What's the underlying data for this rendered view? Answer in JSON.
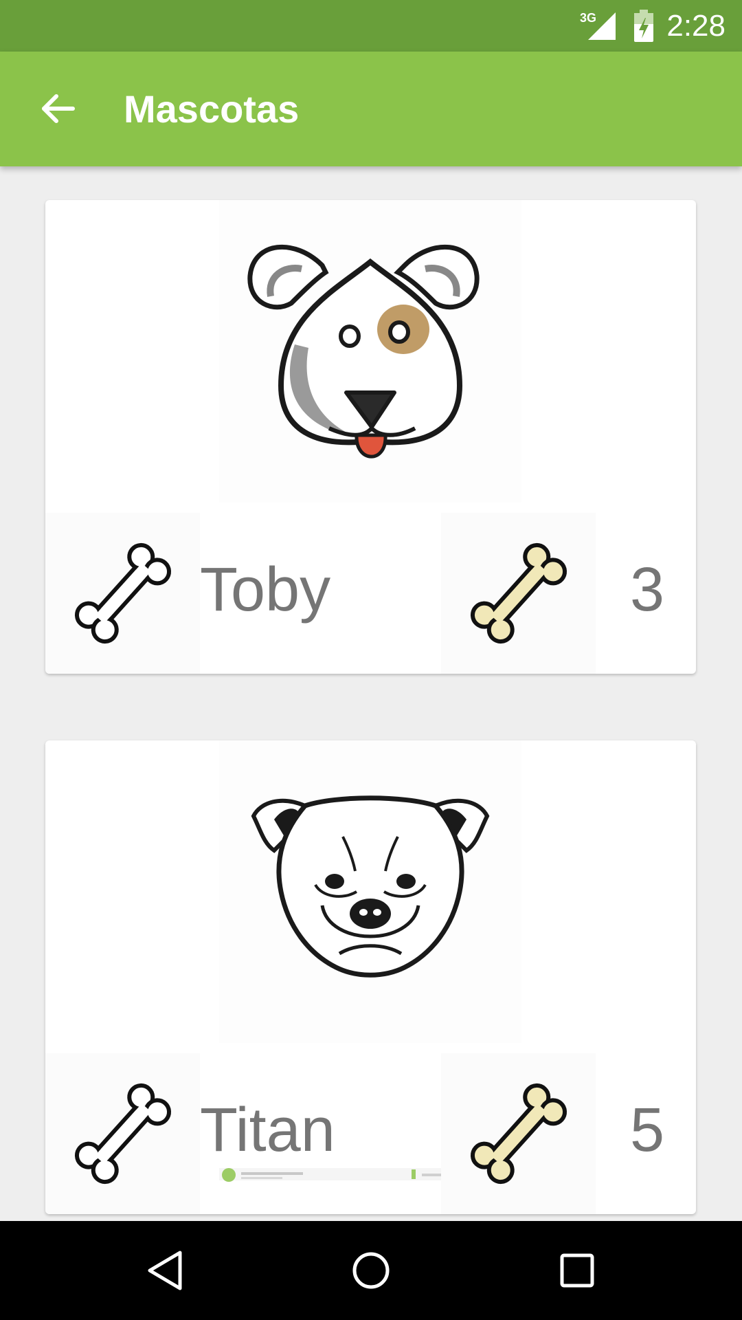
{
  "status_bar": {
    "network": "3G",
    "time": "2:28"
  },
  "app_bar": {
    "back_icon": "arrow-back-icon",
    "title": "Mascotas"
  },
  "pets": [
    {
      "name": "Toby",
      "rating": "3",
      "photo_icon": "cartoon-dog-face-icon"
    },
    {
      "name": "Titan",
      "rating": "5",
      "photo_icon": "bulldog-face-icon"
    }
  ],
  "icons": {
    "rate_button": "bone-outline-icon",
    "rating_icon": "bone-filled-icon"
  },
  "colors": {
    "status_bar": "#699f3a",
    "app_bar": "#8bc34a",
    "background": "#eeeeee",
    "card": "#ffffff",
    "text_secondary": "#757575",
    "bone_fill": "#f1e8b8"
  },
  "nav_bar": {
    "back_icon": "nav-back-triangle-icon",
    "home_icon": "nav-home-circle-icon",
    "recents_icon": "nav-recents-square-icon"
  }
}
